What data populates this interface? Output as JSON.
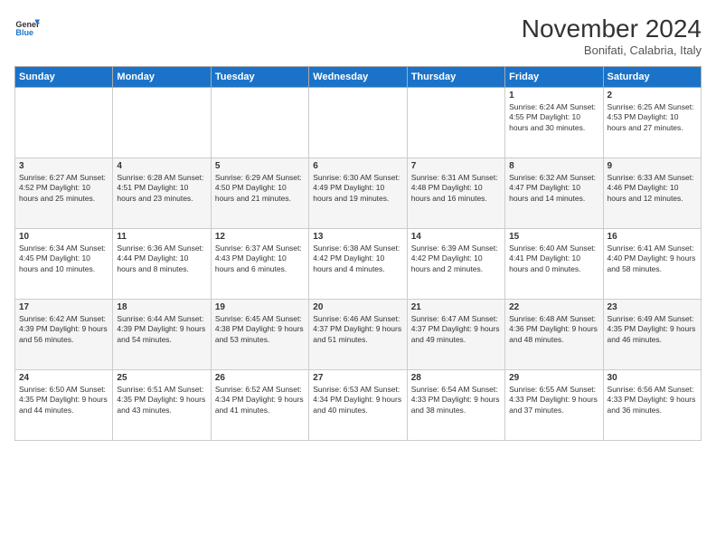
{
  "header": {
    "logo_line1": "General",
    "logo_line2": "Blue",
    "title": "November 2024",
    "subtitle": "Bonifati, Calabria, Italy"
  },
  "days_of_week": [
    "Sunday",
    "Monday",
    "Tuesday",
    "Wednesday",
    "Thursday",
    "Friday",
    "Saturday"
  ],
  "weeks": [
    [
      {
        "day": "",
        "text": ""
      },
      {
        "day": "",
        "text": ""
      },
      {
        "day": "",
        "text": ""
      },
      {
        "day": "",
        "text": ""
      },
      {
        "day": "",
        "text": ""
      },
      {
        "day": "1",
        "text": "Sunrise: 6:24 AM\nSunset: 4:55 PM\nDaylight: 10 hours and 30 minutes."
      },
      {
        "day": "2",
        "text": "Sunrise: 6:25 AM\nSunset: 4:53 PM\nDaylight: 10 hours and 27 minutes."
      }
    ],
    [
      {
        "day": "3",
        "text": "Sunrise: 6:27 AM\nSunset: 4:52 PM\nDaylight: 10 hours and 25 minutes."
      },
      {
        "day": "4",
        "text": "Sunrise: 6:28 AM\nSunset: 4:51 PM\nDaylight: 10 hours and 23 minutes."
      },
      {
        "day": "5",
        "text": "Sunrise: 6:29 AM\nSunset: 4:50 PM\nDaylight: 10 hours and 21 minutes."
      },
      {
        "day": "6",
        "text": "Sunrise: 6:30 AM\nSunset: 4:49 PM\nDaylight: 10 hours and 19 minutes."
      },
      {
        "day": "7",
        "text": "Sunrise: 6:31 AM\nSunset: 4:48 PM\nDaylight: 10 hours and 16 minutes."
      },
      {
        "day": "8",
        "text": "Sunrise: 6:32 AM\nSunset: 4:47 PM\nDaylight: 10 hours and 14 minutes."
      },
      {
        "day": "9",
        "text": "Sunrise: 6:33 AM\nSunset: 4:46 PM\nDaylight: 10 hours and 12 minutes."
      }
    ],
    [
      {
        "day": "10",
        "text": "Sunrise: 6:34 AM\nSunset: 4:45 PM\nDaylight: 10 hours and 10 minutes."
      },
      {
        "day": "11",
        "text": "Sunrise: 6:36 AM\nSunset: 4:44 PM\nDaylight: 10 hours and 8 minutes."
      },
      {
        "day": "12",
        "text": "Sunrise: 6:37 AM\nSunset: 4:43 PM\nDaylight: 10 hours and 6 minutes."
      },
      {
        "day": "13",
        "text": "Sunrise: 6:38 AM\nSunset: 4:42 PM\nDaylight: 10 hours and 4 minutes."
      },
      {
        "day": "14",
        "text": "Sunrise: 6:39 AM\nSunset: 4:42 PM\nDaylight: 10 hours and 2 minutes."
      },
      {
        "day": "15",
        "text": "Sunrise: 6:40 AM\nSunset: 4:41 PM\nDaylight: 10 hours and 0 minutes."
      },
      {
        "day": "16",
        "text": "Sunrise: 6:41 AM\nSunset: 4:40 PM\nDaylight: 9 hours and 58 minutes."
      }
    ],
    [
      {
        "day": "17",
        "text": "Sunrise: 6:42 AM\nSunset: 4:39 PM\nDaylight: 9 hours and 56 minutes."
      },
      {
        "day": "18",
        "text": "Sunrise: 6:44 AM\nSunset: 4:39 PM\nDaylight: 9 hours and 54 minutes."
      },
      {
        "day": "19",
        "text": "Sunrise: 6:45 AM\nSunset: 4:38 PM\nDaylight: 9 hours and 53 minutes."
      },
      {
        "day": "20",
        "text": "Sunrise: 6:46 AM\nSunset: 4:37 PM\nDaylight: 9 hours and 51 minutes."
      },
      {
        "day": "21",
        "text": "Sunrise: 6:47 AM\nSunset: 4:37 PM\nDaylight: 9 hours and 49 minutes."
      },
      {
        "day": "22",
        "text": "Sunrise: 6:48 AM\nSunset: 4:36 PM\nDaylight: 9 hours and 48 minutes."
      },
      {
        "day": "23",
        "text": "Sunrise: 6:49 AM\nSunset: 4:35 PM\nDaylight: 9 hours and 46 minutes."
      }
    ],
    [
      {
        "day": "24",
        "text": "Sunrise: 6:50 AM\nSunset: 4:35 PM\nDaylight: 9 hours and 44 minutes."
      },
      {
        "day": "25",
        "text": "Sunrise: 6:51 AM\nSunset: 4:35 PM\nDaylight: 9 hours and 43 minutes."
      },
      {
        "day": "26",
        "text": "Sunrise: 6:52 AM\nSunset: 4:34 PM\nDaylight: 9 hours and 41 minutes."
      },
      {
        "day": "27",
        "text": "Sunrise: 6:53 AM\nSunset: 4:34 PM\nDaylight: 9 hours and 40 minutes."
      },
      {
        "day": "28",
        "text": "Sunrise: 6:54 AM\nSunset: 4:33 PM\nDaylight: 9 hours and 38 minutes."
      },
      {
        "day": "29",
        "text": "Sunrise: 6:55 AM\nSunset: 4:33 PM\nDaylight: 9 hours and 37 minutes."
      },
      {
        "day": "30",
        "text": "Sunrise: 6:56 AM\nSunset: 4:33 PM\nDaylight: 9 hours and 36 minutes."
      }
    ]
  ]
}
